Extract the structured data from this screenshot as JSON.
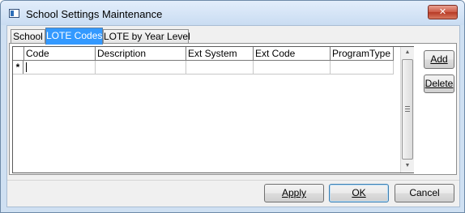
{
  "window": {
    "title": "School Settings Maintenance",
    "close_glyph": "✕"
  },
  "tabs": [
    {
      "label": "School",
      "active": false
    },
    {
      "label": "LOTE Codes",
      "active": true
    },
    {
      "label": "LOTE by Year Level",
      "active": false
    }
  ],
  "grid": {
    "columns": [
      "Code",
      "Description",
      "Ext System",
      "Ext Code",
      "ProgramType"
    ],
    "new_row_indicator": "*",
    "rows": []
  },
  "side_buttons": {
    "add_label": "Add",
    "delete_label": "Delete"
  },
  "footer_buttons": {
    "apply_label": "Apply",
    "ok_label": "OK",
    "cancel_label": "Cancel"
  },
  "colors": {
    "active_tab": "#3399ff",
    "title_bar": "#c9dcf2",
    "close_button": "#c75039"
  }
}
